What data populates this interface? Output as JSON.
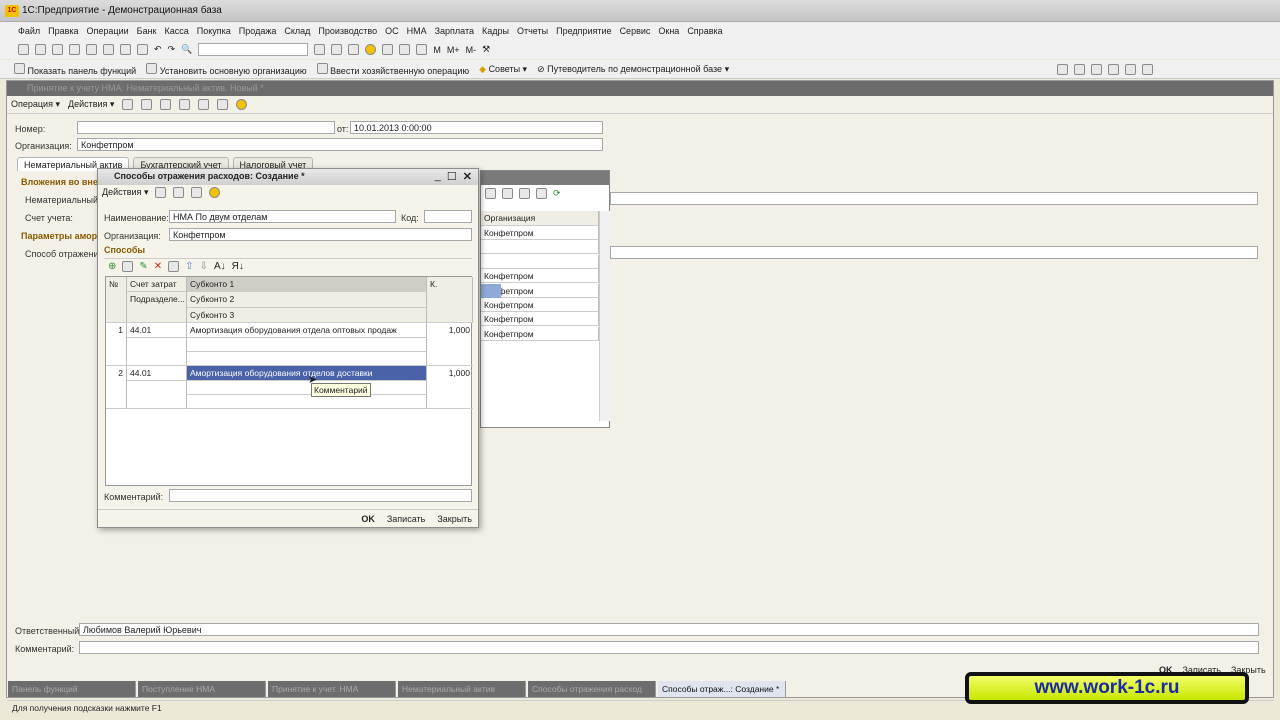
{
  "app": {
    "title": "1С:Предприятие - Демонстрационная база",
    "logo": "1С"
  },
  "menu": [
    "Файл",
    "Правка",
    "Операции",
    "Банк",
    "Касса",
    "Покупка",
    "Продажа",
    "Склад",
    "Производство",
    "ОС",
    "НМА",
    "Зарплата",
    "Кадры",
    "Отчеты",
    "Предприятие",
    "Сервис",
    "Окна",
    "Справка"
  ],
  "toolbar1": {
    "calc_labels": [
      "M",
      "M+",
      "M-"
    ]
  },
  "toolbar2": [
    "Показать панель функций",
    "Установить основную организацию",
    "Ввести хозяйственную операцию",
    "Советы",
    "Путеводитель по демонстрационной базе"
  ],
  "doc": {
    "title": "Принятие к учету НМА: Нематериальный актив. Новый *",
    "toolbar": [
      "Операция",
      "Действия"
    ],
    "number_label": "Номер:",
    "number_value": "",
    "date_label": "от:",
    "date_value": "10.01.2013  0:00:00",
    "org_label": "Организация:",
    "org_value": "Конфетпром",
    "tabs": [
      "Нематериальный актив",
      "Бухгалтерский учет",
      "Налоговый учет"
    ],
    "section1": "Вложения во вне...",
    "field_nma": "Нематериальный а...",
    "field_account": "Счет учета:",
    "section2": "Параметры амор...",
    "field_method": "Способ отражения",
    "responsible_label": "Ответственный:",
    "responsible_value": "Любимов Валерий Юрьевич",
    "comment_label": "Комментарий:",
    "comment_value": "",
    "buttons": [
      "OK",
      "Записать",
      "Закрыть"
    ]
  },
  "list": {
    "column": "Организация",
    "rows": [
      "Конфетпром",
      "",
      "",
      "Конфетпром",
      "Конфетпром",
      "Конфетпром",
      "Конфетпром",
      "Конфетпром"
    ]
  },
  "dialog": {
    "title": "Способы отражения расходов: Создание *",
    "actions": "Действия",
    "name_label": "Наименование:",
    "name_value": "НМА По двум отделам",
    "code_label": "Код:",
    "code_value": "",
    "org_label": "Организация:",
    "org_value": "Конфетпром",
    "section": "Способы",
    "columns": {
      "num": "№",
      "account": "Счет затрат",
      "dept": "Подразделе...",
      "sub1": "Субконто 1",
      "sub2": "Субконто 2",
      "sub3": "Субконто 3",
      "coef": "К."
    },
    "rows": [
      {
        "num": "1",
        "account": "44.01",
        "sub1": "Амортизация оборудования отдела оптовых продаж",
        "coef": "1,000"
      },
      {
        "num": "2",
        "account": "44.01",
        "sub1": "Амортизация оборудования отделов доставки",
        "coef": "1,000"
      }
    ],
    "tooltip": "Комментарий",
    "comment_label": "Комментарий:",
    "comment_value": "",
    "buttons": [
      "OK",
      "Записать",
      "Закрыть"
    ]
  },
  "taskbar": [
    "Панель функций",
    "Поступление НМА",
    "Принятие к учет. НМА",
    "Нематериальный актив",
    "Способы отражения расход",
    "Способы отраж...: Создание *"
  ],
  "status": "Для получения подсказки нажмите F1",
  "watermark": "www.work-1c.ru",
  "colors": {
    "selection": "#4a63a8",
    "section": "#8a5a00",
    "inactive_title": "#6c6c6c"
  }
}
